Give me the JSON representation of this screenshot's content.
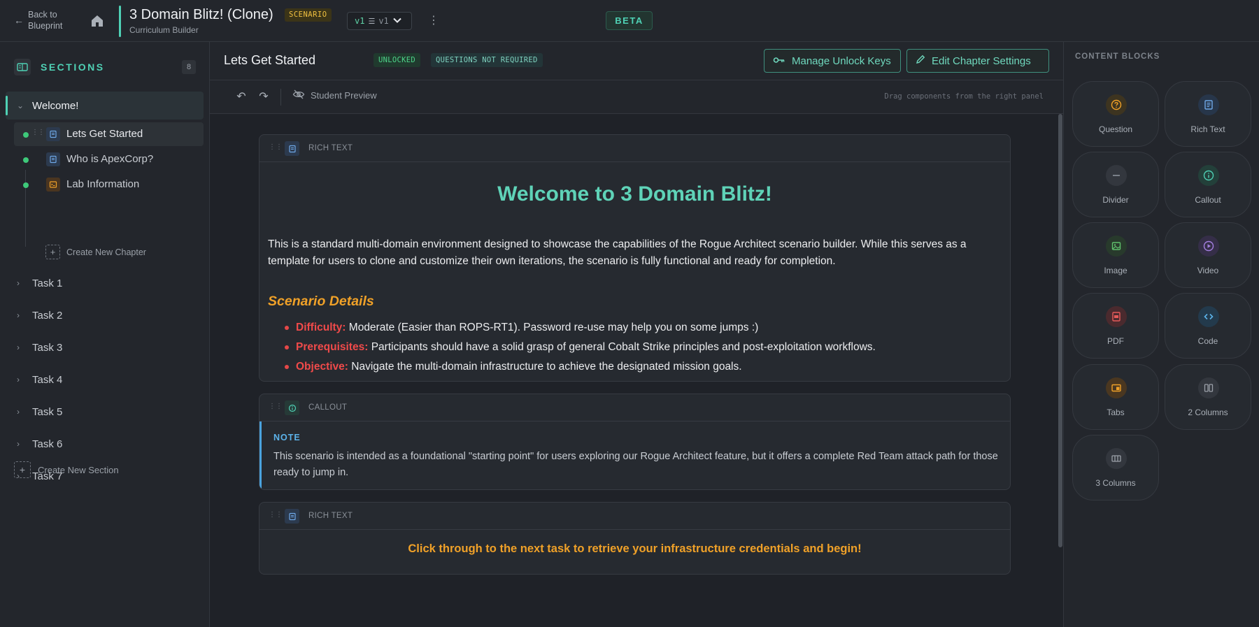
{
  "topbar": {
    "back_label_line1": "Back to",
    "back_label_line2": "Blueprint",
    "title": "3 Domain Blitz! (Clone)",
    "badge": "SCENARIO",
    "subtitle": "Curriculum Builder",
    "version_main": "v1",
    "version_sub": "v1",
    "beta": "BETA"
  },
  "sidebar": {
    "title": "SECTIONS",
    "count": "8",
    "sections": [
      {
        "label": "Welcome!",
        "expanded": true
      },
      {
        "label": "Task 1"
      },
      {
        "label": "Task 2"
      },
      {
        "label": "Task 3"
      },
      {
        "label": "Task 4"
      },
      {
        "label": "Task 5"
      },
      {
        "label": "Task 6"
      },
      {
        "label": "Task 7"
      }
    ],
    "chapters": [
      {
        "label": "Lets Get Started",
        "icon": "document-icon"
      },
      {
        "label": "Who is ApexCorp?",
        "icon": "document-icon"
      },
      {
        "label": "Lab Information",
        "icon": "terminal-icon"
      }
    ],
    "create_chapter": "Create New Chapter",
    "create_section": "Create New Section"
  },
  "chapter": {
    "title": "Lets Get Started",
    "status_unlocked": "UNLOCKED",
    "status_questions": "QUESTIONS NOT REQUIRED",
    "manage_keys": "Manage Unlock Keys",
    "edit_settings": "Edit Chapter Settings"
  },
  "toolbar": {
    "preview": "Student Preview",
    "hint": "Drag components from the right panel"
  },
  "blocks": {
    "rich_text_label": "RICH TEXT",
    "callout_label": "CALLOUT",
    "welcome_heading": "Welcome to 3 Domain Blitz!",
    "intro": "This is a standard multi-domain environment designed to showcase the capabilities of the Rogue Architect scenario builder. While this serves as a template for users to clone and customize their own iterations, the scenario is fully functional and ready for completion.",
    "details_heading": "Scenario Details",
    "details": [
      {
        "key": "Difficulty:",
        "text": "Moderate (Easier than ROPS-RT1). Password re-use may help you on some jumps :)"
      },
      {
        "key": "Prerequisites:",
        "text": "Participants should have a solid grasp of general Cobalt Strike principles and post-exploitation workflows."
      },
      {
        "key": "Objective:",
        "text": "Navigate the multi-domain infrastructure to achieve the designated mission goals."
      }
    ],
    "note_label": "NOTE",
    "note_text": "This scenario is intended as a foundational \"starting point\" for users exploring our Rogue Architect feature, but it offers a complete Red Team attack path for those ready to jump in.",
    "cta": "Click through to the next task to retrieve your infrastructure credentials and begin!"
  },
  "content_blocks": {
    "title": "CONTENT BLOCKS",
    "items": [
      {
        "label": "Question",
        "icon": "question-icon"
      },
      {
        "label": "Rich Text",
        "icon": "document-icon"
      },
      {
        "label": "Divider",
        "icon": "divider-icon"
      },
      {
        "label": "Callout",
        "icon": "info-icon"
      },
      {
        "label": "Image",
        "icon": "image-icon"
      },
      {
        "label": "Video",
        "icon": "play-icon"
      },
      {
        "label": "PDF",
        "icon": "pdf-icon"
      },
      {
        "label": "Code",
        "icon": "code-icon"
      },
      {
        "label": "Tabs",
        "icon": "tabs-icon"
      },
      {
        "label": "2 Columns",
        "icon": "two-columns-icon"
      },
      {
        "label": "3 Columns",
        "icon": "three-columns-icon"
      }
    ]
  },
  "colors": {
    "accent": "#4fd1b5",
    "heading_teal": "#5fd3b8",
    "orange": "#f0a128",
    "red": "#f04a4a",
    "note_blue": "#5cb3ea",
    "status_green": "#3ec97a"
  }
}
